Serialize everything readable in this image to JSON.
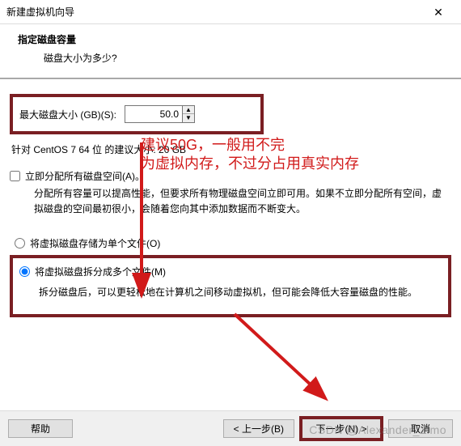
{
  "window": {
    "title": "新建虚拟机向导",
    "close": "✕"
  },
  "header": {
    "heading": "指定磁盘容量",
    "sub": "磁盘大小为多少?"
  },
  "size": {
    "label": "最大磁盘大小 (GB)(S):",
    "value": "50.0"
  },
  "recommended": "针对 CentOS 7 64 位 的建议大小: 20 GB",
  "allocate": {
    "label": "立即分配所有磁盘空间(A)。",
    "desc": "分配所有容量可以提高性能，但要求所有物理磁盘空间立即可用。如果不立即分配所有空间，虚拟磁盘的空间最初很小，会随着您向其中添加数据而不断变大。"
  },
  "radios": {
    "single": "将虚拟磁盘存储为单个文件(O)",
    "split": "将虚拟磁盘拆分成多个文件(M)",
    "split_desc": "拆分磁盘后，可以更轻松地在计算机之间移动虚拟机，但可能会降低大容量磁盘的性能。"
  },
  "footer": {
    "help": "帮助",
    "back": "< 上一步(B)",
    "next": "下一步(N) >",
    "cancel": "取消"
  },
  "annotation": {
    "line1": "建议50G，一般用不完",
    "line2": "为虚拟内存，不过分占用真实内存"
  },
  "watermark": "CSDN @Alexander_Zimo"
}
